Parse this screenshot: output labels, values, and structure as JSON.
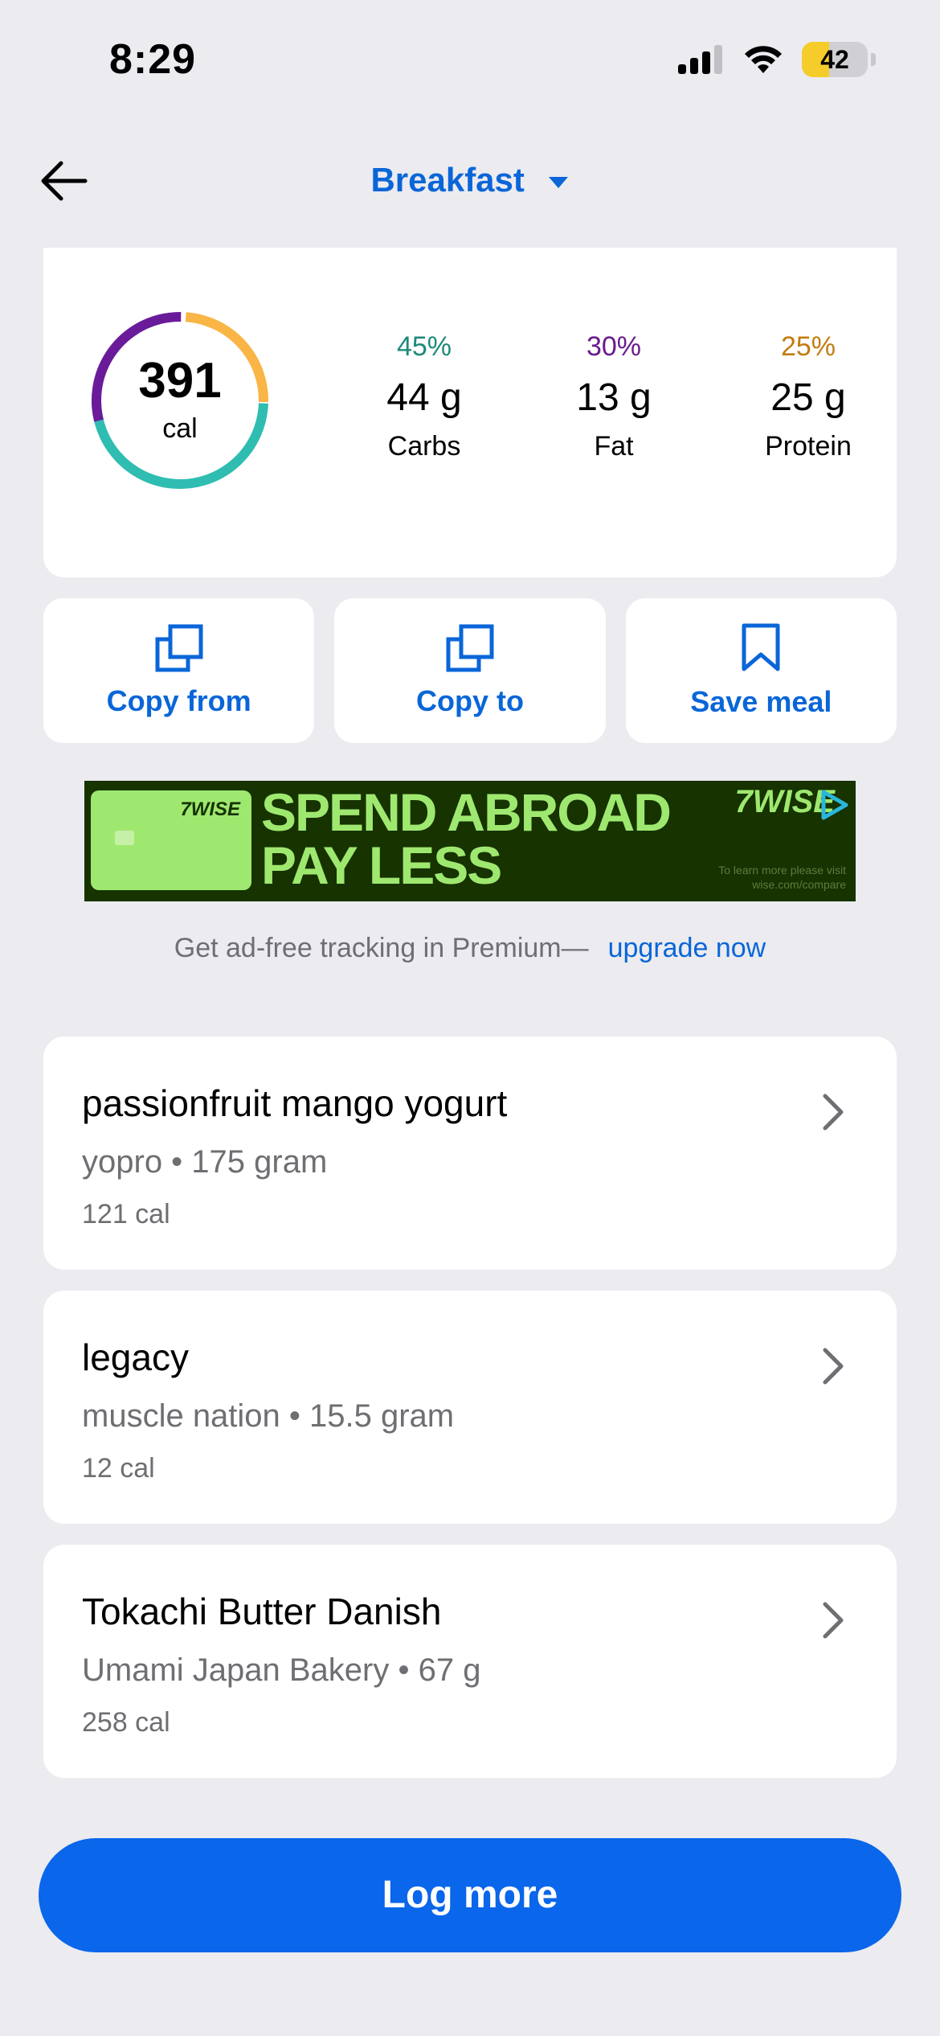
{
  "status_bar": {
    "time": "8:29",
    "battery": "42"
  },
  "nav": {
    "title": "Breakfast"
  },
  "summary": {
    "calories": "391",
    "calories_unit": "cal",
    "macros": [
      {
        "percent": "45%",
        "grams": "44 g",
        "name": "Carbs",
        "color": "#1e8a7a"
      },
      {
        "percent": "30%",
        "grams": "13 g",
        "name": "Fat",
        "color": "#6a1b8a"
      },
      {
        "percent": "25%",
        "grams": "25 g",
        "name": "Protein",
        "color": "#c27d10"
      }
    ],
    "ring_colors": {
      "carbs": "#2fbdb2",
      "fat": "#6a1b9a",
      "protein": "#f9b545"
    }
  },
  "actions": [
    {
      "label": "Copy from",
      "icon": "copy-icon"
    },
    {
      "label": "Copy to",
      "icon": "copy-icon"
    },
    {
      "label": "Save meal",
      "icon": "bookmark-icon"
    }
  ],
  "ad": {
    "brand": "7WISE",
    "card_brand": "7WISE",
    "headline_line1": "SPEND ABROAD",
    "headline_line2": "PAY LESS",
    "fine_print": "To learn more please visit wise.com/compare"
  },
  "premium": {
    "text": "Get ad-free tracking in Premium—",
    "link": "upgrade now"
  },
  "foods": [
    {
      "name": "passionfruit mango yogurt",
      "meta": "yopro • 175 gram",
      "calories": "121 cal"
    },
    {
      "name": "legacy",
      "meta": "muscle nation • 15.5 gram",
      "calories": "12 cal"
    },
    {
      "name": "Tokachi Butter Danish",
      "meta": "Umami Japan Bakery • 67 g",
      "calories": "258 cal"
    }
  ],
  "log_more": {
    "label": "Log more"
  }
}
